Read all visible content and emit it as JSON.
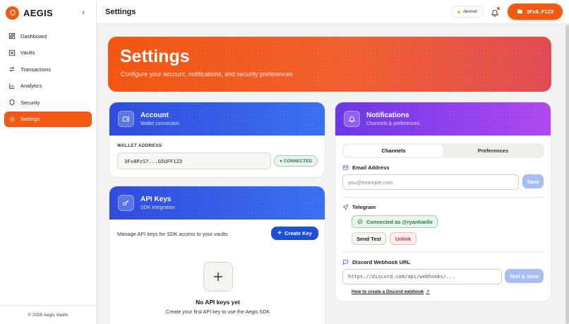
{
  "brand": {
    "name": "AEGIS",
    "collapse_icon": "chevron-left-icon"
  },
  "sidebar": {
    "items": [
      {
        "label": "Dashboard",
        "icon": "grid-icon",
        "active": false
      },
      {
        "label": "Vaults",
        "icon": "vault-icon",
        "active": false
      },
      {
        "label": "Transactions",
        "icon": "arrows-icon",
        "active": false
      },
      {
        "label": "Analytics",
        "icon": "chart-icon",
        "active": false
      },
      {
        "label": "Security",
        "icon": "shield-icon",
        "active": false
      },
      {
        "label": "Settings",
        "icon": "gear-icon",
        "active": true
      }
    ],
    "footer": "© 2025 Aegis Vaults"
  },
  "header": {
    "title": "Settings",
    "network": "devnet",
    "wallet_label": "3Fx8..F1Z3"
  },
  "hero": {
    "title": "Settings",
    "subtitle": "Configure your account, notifications, and security preferences"
  },
  "account": {
    "title": "Account",
    "subtitle": "Wallet connection",
    "address_label": "WALLET ADDRESS",
    "address": "3Fx8PzS7...G5UFF1Z3",
    "status": "● CONNECTED"
  },
  "api_keys": {
    "title": "API Keys",
    "subtitle": "SDK integration",
    "description": "Manage API keys for SDK access to your vaults",
    "create_label": "Create Key",
    "empty_title": "No API keys yet",
    "empty_sub": "Create your first API key to use the Aegis SDK"
  },
  "notifications": {
    "title": "Notifications",
    "subtitle": "Channels & preferences",
    "tabs": [
      {
        "label": "Channels",
        "active": true
      },
      {
        "label": "Preferences",
        "active": false
      }
    ],
    "email": {
      "label": "Email Address",
      "placeholder": "you@example.com",
      "save_label": "Save"
    },
    "telegram": {
      "label": "Telegram",
      "status": "Connected as @ryankaelle",
      "send_test_label": "Send Test",
      "unlink_label": "Unlink"
    },
    "discord": {
      "label": "Discord Webhook URL",
      "placeholder": "https://discord.com/api/webhooks/...",
      "save_label": "Test & Save",
      "help_link": "How to create a Discord webhook"
    }
  },
  "colors": {
    "accent": "#f05a12",
    "blue": "#1e4fd8",
    "purple": "#8a3fe9",
    "success": "#2c7a4a",
    "danger": "#d23a3a"
  }
}
